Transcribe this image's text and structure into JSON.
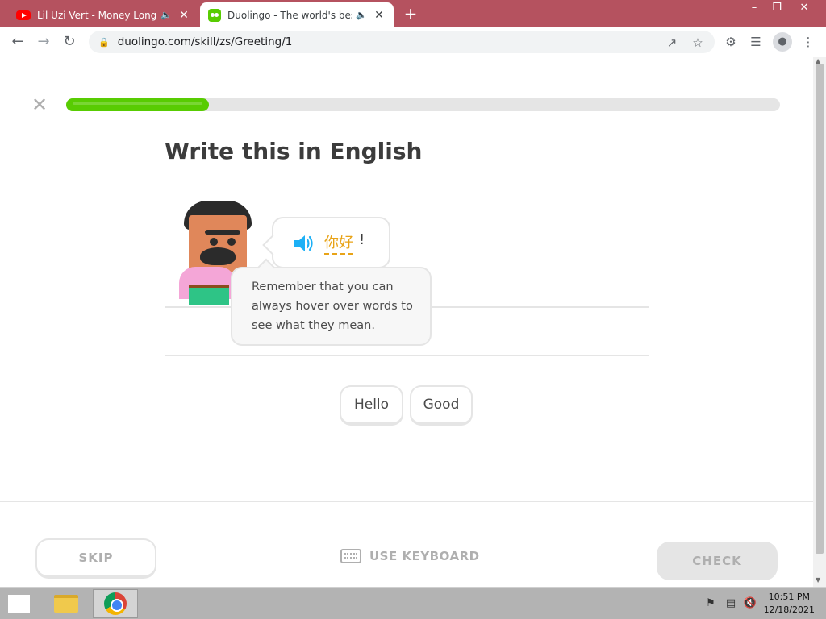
{
  "browser": {
    "tabs": [
      {
        "title": "Lil Uzi Vert - Money Longer |",
        "favicon": "youtube-icon",
        "audio": true,
        "active": false
      },
      {
        "title": "Duolingo - The world's best",
        "favicon": "duolingo-icon",
        "audio": true,
        "active": true
      }
    ],
    "new_tab_label": "+",
    "url": "duolingo.com/skill/zs/Greeting/1",
    "accent_color": "#b5525f"
  },
  "lesson": {
    "progress": 0.2,
    "heading": "Write this in English",
    "prompt_word": "你好",
    "prompt_punct": "!",
    "tooltip": "Remember that you can always hover over words to see what they mean.",
    "word_bank": [
      "Hello",
      "Good"
    ],
    "skip_label": "SKIP",
    "use_keyboard_label": "USE KEYBOARD",
    "check_label": "CHECK",
    "colors": {
      "progress": "#58cc02",
      "prompt_word": "#e8a317",
      "speaker": "#1cb0f6"
    }
  },
  "taskbar": {
    "time": "10:51 PM",
    "date": "12/18/2021",
    "apps": [
      "file-explorer-icon",
      "chrome-icon"
    ]
  }
}
